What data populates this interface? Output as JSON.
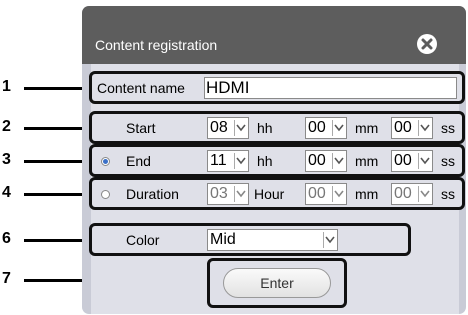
{
  "dialog": {
    "title": "Content registration",
    "close_icon": "close-circle-icon"
  },
  "callouts": [
    "1",
    "2",
    "3",
    "4",
    "6",
    "7"
  ],
  "content_name": {
    "label": "Content name",
    "value": "HDMI"
  },
  "start": {
    "label": "Start",
    "hours": "08",
    "hours_unit": "hh",
    "minutes": "00",
    "minutes_unit": "mm",
    "seconds": "00",
    "seconds_unit": "ss"
  },
  "end": {
    "label": "End",
    "selected": true,
    "hours": "11",
    "hours_unit": "hh",
    "minutes": "00",
    "minutes_unit": "mm",
    "seconds": "00",
    "seconds_unit": "ss"
  },
  "duration": {
    "label": "Duration",
    "selected": false,
    "hours": "03",
    "hours_unit": "Hour",
    "minutes": "00",
    "minutes_unit": "mm",
    "seconds": "00",
    "seconds_unit": "ss"
  },
  "color": {
    "label": "Color",
    "value": "Mid"
  },
  "enter_button": {
    "label": "Enter"
  },
  "colors": {
    "titlebar": "#5d5d5d",
    "dialog_body": "#dfe0e8",
    "radio_selected": "#3a6fc7"
  }
}
